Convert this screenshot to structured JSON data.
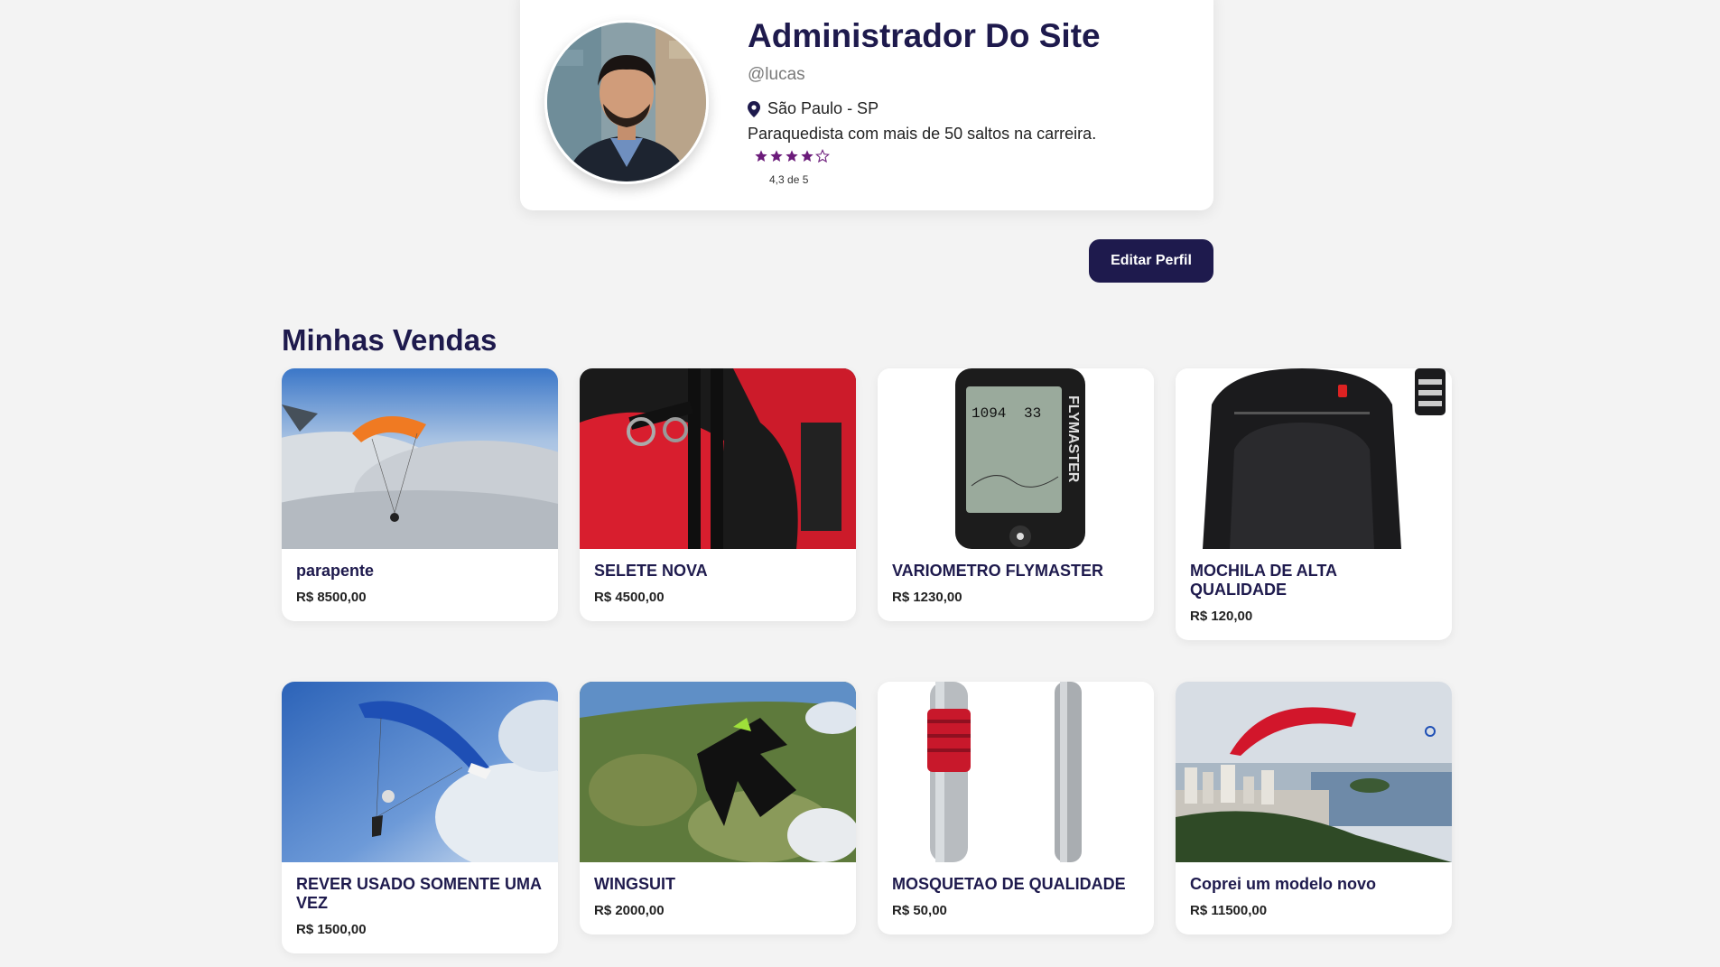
{
  "profile": {
    "name": "Administrador Do Site",
    "handle": "@lucas",
    "location": "São Paulo - SP",
    "bio": "Paraquedista com mais de 50 saltos na carreira.",
    "rating_text": "4,3 de 5",
    "rating_value": 4.3,
    "rating_max": 5,
    "edit_button": "Editar Perfil"
  },
  "sales": {
    "title": "Minhas Vendas",
    "items": [
      {
        "title": "parapente",
        "price": "R$ 8500,00"
      },
      {
        "title": "SELETE NOVA",
        "price": "R$ 4500,00"
      },
      {
        "title": "VARIOMETRO FLYMASTER",
        "price": "R$ 1230,00"
      },
      {
        "title": "MOCHILA DE ALTA QUALIDADE",
        "price": "R$ 120,00"
      },
      {
        "title": "REVER USADO SOMENTE UMA VEZ",
        "price": "R$ 1500,00"
      },
      {
        "title": "WINGSUIT",
        "price": "R$ 2000,00"
      },
      {
        "title": "MOSQUETAO DE QUALIDADE",
        "price": "R$ 50,00"
      },
      {
        "title": "Coprei um modelo novo",
        "price": "R$ 11500,00"
      }
    ]
  },
  "colors": {
    "brand": "#1e1a4d",
    "star": "#6b1b7a",
    "background": "#f3f3f3"
  }
}
